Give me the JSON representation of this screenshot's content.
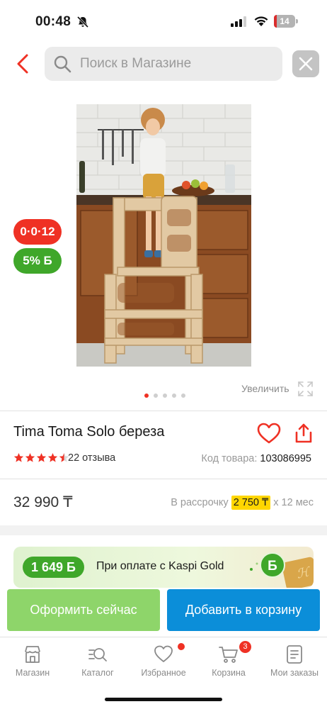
{
  "status_bar": {
    "time": "00:48",
    "battery_level": "14"
  },
  "search": {
    "placeholder": "Поиск в Магазине"
  },
  "product": {
    "badges": {
      "installment": "0·0·12",
      "bonus": "5% Б"
    },
    "gallery": {
      "image_count": 5,
      "active_index": 0,
      "zoom_label": "Увеличить"
    },
    "title": "Tima Toma Solo береза",
    "rating": 4.5,
    "reviews": "22 отзыва",
    "sku_label": "Код товара:",
    "sku_value": "103086995",
    "price": "32 990 ₸",
    "installment_prefix": "В рассрочку",
    "installment_amount": "2 750 ₸",
    "installment_suffix": "х 12 мес"
  },
  "gold_banner": {
    "bonus": "1 649 Б",
    "text": "При оплате с Kaspi Gold"
  },
  "actions": {
    "checkout_label": "Оформить сейчас",
    "add_to_cart_label": "Добавить в корзину"
  },
  "tabs": [
    {
      "label": "Магазин",
      "icon": "store-icon"
    },
    {
      "label": "Каталог",
      "icon": "catalog-search-icon"
    },
    {
      "label": "Избранное",
      "icon": "heart-icon"
    },
    {
      "label": "Корзина",
      "icon": "cart-icon",
      "badge": "3"
    },
    {
      "label": "Мои заказы",
      "icon": "orders-icon"
    }
  ],
  "colors": {
    "accent_red": "#ef3124",
    "kaspi_green": "#3fa72a",
    "checkout_green": "#8ed56a",
    "cart_blue": "#0b8ed9",
    "highlight_yellow": "#ffd600"
  }
}
